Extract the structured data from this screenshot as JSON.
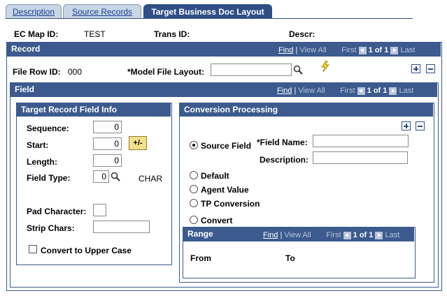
{
  "tabs": [
    {
      "label": "Description",
      "active": false
    },
    {
      "label": "Source Records",
      "active": false
    },
    {
      "label": "Target Business Doc Layout",
      "active": true
    }
  ],
  "header": {
    "ec_map_id_label": "EC Map ID:",
    "ec_map_id_value": "TEST",
    "trans_id_label": "Trans ID:",
    "descr_label": "Descr:"
  },
  "record": {
    "title": "Record",
    "nav": {
      "find": "Find",
      "sep": "|",
      "view_all": "View All",
      "first": "First",
      "count": "1 of 1",
      "last": "Last"
    },
    "file_row_id_label": "File Row ID:",
    "file_row_id_value": "000",
    "model_file_layout_label": "*Model File Layout:",
    "model_file_layout_value": ""
  },
  "field": {
    "title": "Field",
    "nav": {
      "find": "Find",
      "sep": "|",
      "view_all": "View All",
      "first": "First",
      "count": "1 of 1",
      "last": "Last"
    }
  },
  "target_info": {
    "title": "Target Record Field Info",
    "sequence_label": "Sequence:",
    "sequence_value": "0",
    "start_label": "Start:",
    "start_value": "0",
    "plusminus_label": "+/-",
    "length_label": "Length:",
    "length_value": "0",
    "field_type_label": "Field Type:",
    "field_type_value": "0",
    "field_type_text": "CHAR",
    "pad_char_label": "Pad Character:",
    "pad_char_value": "",
    "strip_chars_label": "Strip Chars:",
    "strip_chars_value": "",
    "upper_case_label": "Convert to Upper Case",
    "upper_case_checked": false
  },
  "conversion": {
    "title": "Conversion Processing",
    "source_field_label": "Source Field",
    "field_name_label": "*Field Name:",
    "field_name_value": "",
    "description_label": "Description:",
    "description_value": "",
    "default_label": "Default",
    "agent_value_label": "Agent Value",
    "tp_conversion_label": "TP Conversion",
    "convert_label": "Convert",
    "selected": "source_field"
  },
  "range": {
    "title": "Range",
    "nav": {
      "find": "Find",
      "sep": "|",
      "view_all": "View All",
      "first": "First",
      "count": "1 of 1",
      "last": "Last"
    },
    "from_label": "From",
    "to_label": "To"
  },
  "colors": {
    "accent": "#3c5a8e",
    "tab_inactive": "#c9d6e6",
    "button": "#f4e08a"
  }
}
